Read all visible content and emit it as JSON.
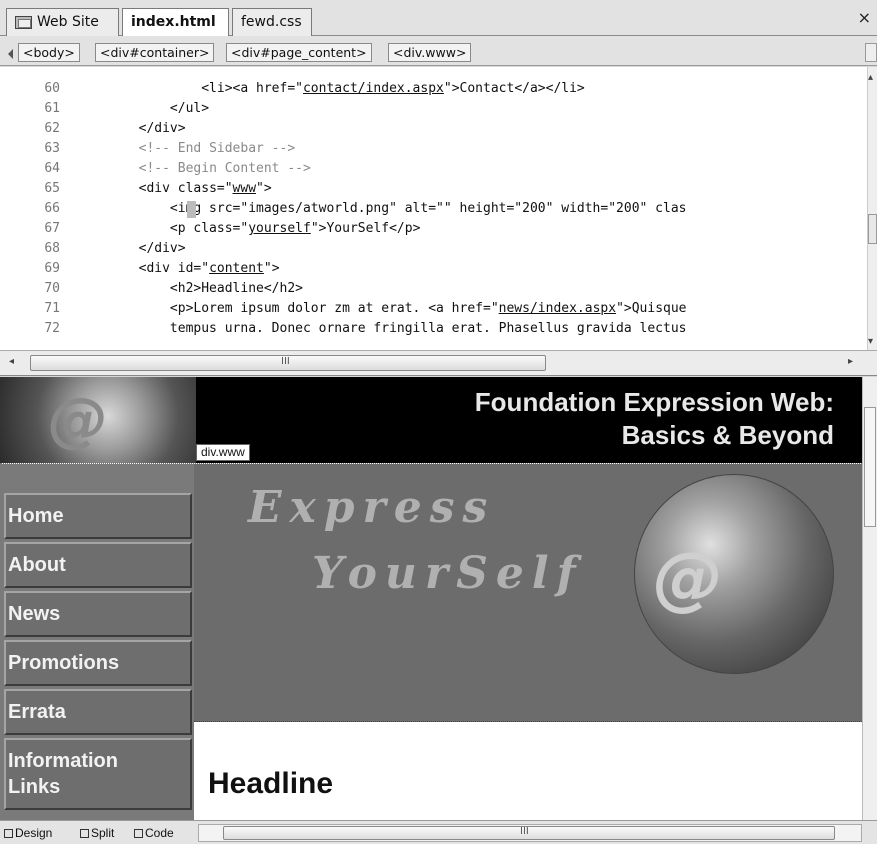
{
  "tabs": {
    "web_site": "Web Site",
    "index": "index.html",
    "css": "fewd.css",
    "close": "×"
  },
  "breadcrumb": [
    "<body>",
    "<div#container>",
    "<div#page_content>",
    "<div.www>"
  ],
  "code": {
    "line_numbers": [
      "60",
      "61",
      "62",
      "63",
      "64",
      "65",
      "66",
      "67",
      "68",
      "69",
      "70",
      "71",
      "72"
    ],
    "lines": [
      {
        "indent": "                ",
        "parts": [
          {
            "t": "<li><a href=\""
          },
          {
            "t": "contact/index.aspx",
            "u": true
          },
          {
            "t": "\">Contact</a></li>"
          }
        ]
      },
      {
        "indent": "            ",
        "parts": [
          {
            "t": "</ul>"
          }
        ]
      },
      {
        "indent": "        ",
        "parts": [
          {
            "t": "</div>"
          }
        ]
      },
      {
        "indent": "        ",
        "parts": [
          {
            "t": "<!-- End Sidebar -->",
            "c": true
          }
        ]
      },
      {
        "indent": "        ",
        "parts": [
          {
            "t": "<!-- Begin Content -->",
            "c": true
          }
        ]
      },
      {
        "indent": "        ",
        "parts": [
          {
            "t": "<div class=\""
          },
          {
            "t": "www",
            "u": true
          },
          {
            "t": "\">"
          }
        ]
      },
      {
        "indent": "            ",
        "parts": [
          {
            "t": "<img src=\"images/atworld.png\" alt=\"\" height=\"200\" width=\"200\" clas"
          }
        ]
      },
      {
        "indent": "            ",
        "parts": [
          {
            "t": "<p class=\""
          },
          {
            "t": "yourself",
            "u": true
          },
          {
            "t": "\">YourSelf</p>"
          }
        ]
      },
      {
        "indent": "        ",
        "parts": [
          {
            "t": "</div>"
          }
        ]
      },
      {
        "indent": "        ",
        "parts": [
          {
            "t": "<div id=\""
          },
          {
            "t": "content",
            "u": true
          },
          {
            "t": "\">"
          }
        ]
      },
      {
        "indent": "            ",
        "parts": [
          {
            "t": "<h2>Headline</h2>"
          }
        ]
      },
      {
        "indent": "            ",
        "parts": [
          {
            "t": "<p>Lorem ipsum dolor zm at erat. <a href=\""
          },
          {
            "t": "news/index.aspx",
            "u": true
          },
          {
            "t": "\">Quisque"
          }
        ]
      },
      {
        "indent": "            ",
        "parts": [
          {
            "t": "tempus urna. Donec ornare fringilla erat. Phasellus gravida lectus"
          }
        ]
      }
    ]
  },
  "site": {
    "logo_text": "@",
    "title_line1": "Foundation Expression Web:",
    "title_line2": "Basics & Beyond",
    "div_tag": "div.www",
    "nav": [
      "Home",
      "About",
      "News",
      "Promotions",
      "Errata",
      "Information Links"
    ],
    "banner_line1": "Express",
    "banner_line2": "YourSelf",
    "globe_text": "@",
    "headline": "Headline"
  },
  "views": {
    "design": "Design",
    "split": "Split",
    "code": "Code"
  },
  "scroll_label": "III"
}
